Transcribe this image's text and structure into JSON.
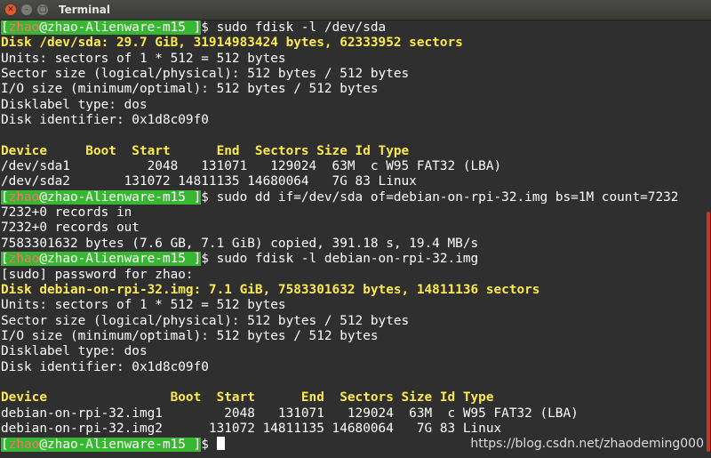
{
  "window": {
    "title": "Terminal",
    "close_glyph": "✕",
    "minimize_glyph": "–",
    "maximize_glyph": "□"
  },
  "prompt": {
    "user": "zhao",
    "at_host": "@zhao-Alienware-m15",
    "suffix": "$ "
  },
  "lines": [
    {
      "type": "cmd",
      "text": "sudo fdisk -l /dev/sda"
    },
    {
      "type": "yellow",
      "text": "Disk /dev/sda: 29.7 GiB, 31914983424 bytes, 62333952 sectors"
    },
    {
      "type": "text",
      "text": "Units: sectors of 1 * 512 = 512 bytes"
    },
    {
      "type": "text",
      "text": "Sector size (logical/physical): 512 bytes / 512 bytes"
    },
    {
      "type": "text",
      "text": "I/O size (minimum/optimal): 512 bytes / 512 bytes"
    },
    {
      "type": "text",
      "text": "Disklabel type: dos"
    },
    {
      "type": "text",
      "text": "Disk identifier: 0x1d8c09f0"
    },
    {
      "type": "text",
      "text": ""
    },
    {
      "type": "yellow",
      "text": "Device     Boot  Start      End  Sectors Size Id Type"
    },
    {
      "type": "text",
      "text": "/dev/sda1          2048   131071   129024  63M  c W95 FAT32 (LBA)"
    },
    {
      "type": "text",
      "text": "/dev/sda2       131072 14811135 14680064   7G 83 Linux"
    },
    {
      "type": "cmd",
      "text": "sudo dd if=/dev/sda of=debian-on-rpi-32.img bs=1M count=7232"
    },
    {
      "type": "text",
      "text": "7232+0 records in"
    },
    {
      "type": "text",
      "text": "7232+0 records out"
    },
    {
      "type": "text",
      "text": "7583301632 bytes (7.6 GB, 7.1 GiB) copied, 391.18 s, 19.4 MB/s"
    },
    {
      "type": "cmd",
      "text": "sudo fdisk -l debian-on-rpi-32.img"
    },
    {
      "type": "text",
      "text": "[sudo] password for zhao:"
    },
    {
      "type": "yellow",
      "text": "Disk debian-on-rpi-32.img: 7.1 GiB, 7583301632 bytes, 14811136 sectors"
    },
    {
      "type": "text",
      "text": "Units: sectors of 1 * 512 = 512 bytes"
    },
    {
      "type": "text",
      "text": "Sector size (logical/physical): 512 bytes / 512 bytes"
    },
    {
      "type": "text",
      "text": "I/O size (minimum/optimal): 512 bytes / 512 bytes"
    },
    {
      "type": "text",
      "text": "Disklabel type: dos"
    },
    {
      "type": "text",
      "text": "Disk identifier: 0x1d8c09f0"
    },
    {
      "type": "text",
      "text": ""
    },
    {
      "type": "yellow",
      "text": "Device                Boot  Start      End  Sectors Size Id Type"
    },
    {
      "type": "text",
      "text": "debian-on-rpi-32.img1        2048   131071   129024  63M  c W95 FAT32 (LBA)"
    },
    {
      "type": "text",
      "text": "debian-on-rpi-32.img2      131072 14811135 14680064   7G 83 Linux"
    },
    {
      "type": "cmd_cursor",
      "text": ""
    }
  ],
  "watermark": "https://blog.csdn.net/zhaodeming000",
  "colors": {
    "background": "#2f2f2f",
    "foreground": "#ffffff",
    "highlight_yellow": "#fce94f",
    "prompt_bg": "#38b832",
    "prompt_user": "#ff6e6e",
    "scroll_thumb": "#c0392b"
  }
}
